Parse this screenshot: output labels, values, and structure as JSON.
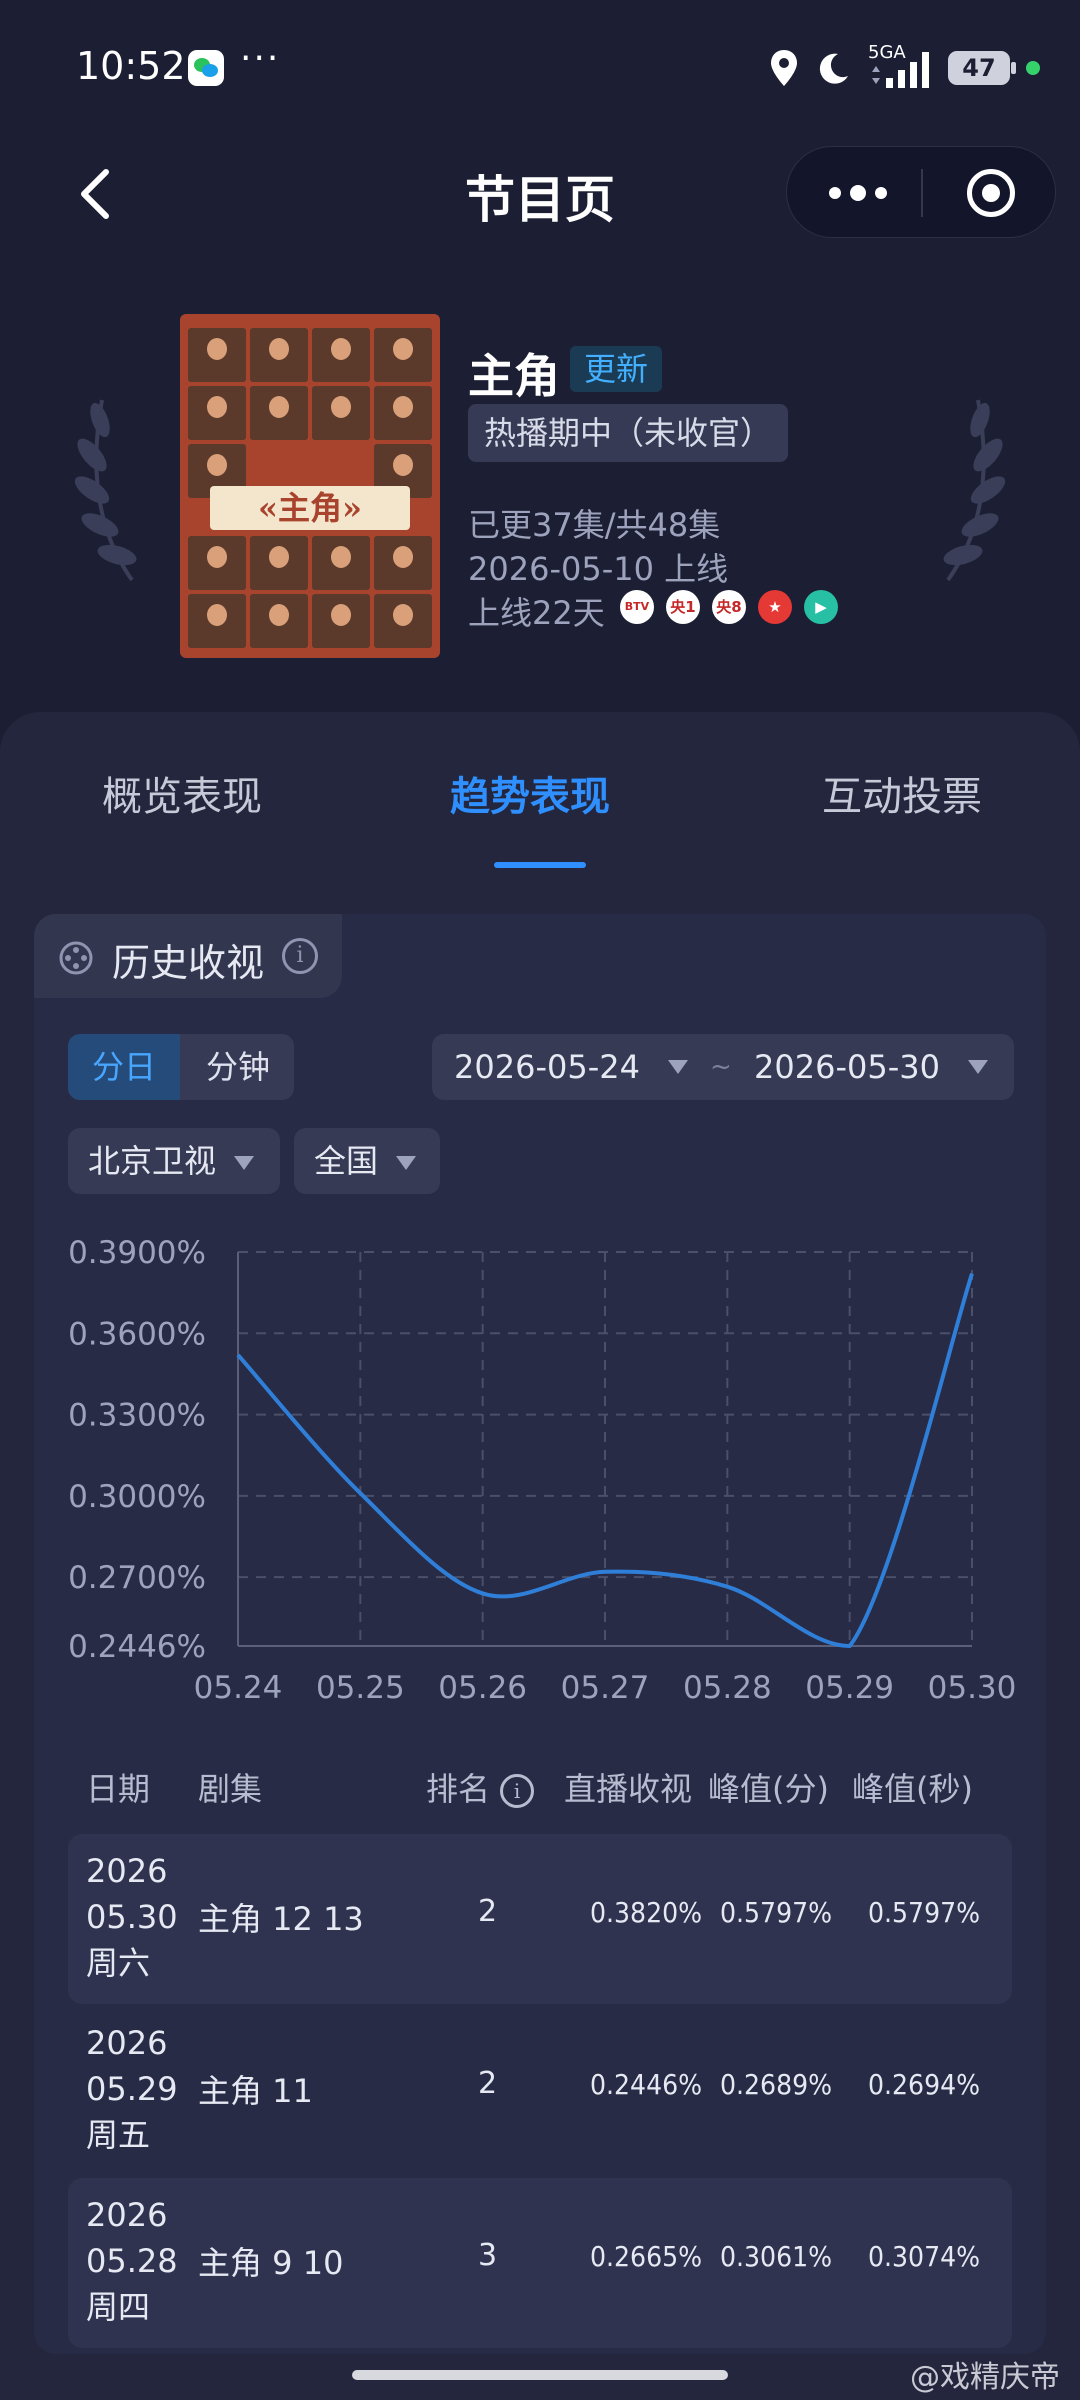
{
  "status_bar": {
    "time": "10:52",
    "more": "···",
    "network": "5GA",
    "battery": "47"
  },
  "nav": {
    "title": "节目页",
    "back_icon": "chevron-left-icon",
    "capsule_icons": [
      "more-icon",
      "target-icon"
    ]
  },
  "show": {
    "name": "主角",
    "badge": "更新",
    "status": "热播期中（未收官）",
    "episodes": "已更37集/共48集",
    "premiere": "2026-05-10 上线",
    "days": "上线22天",
    "poster_title": "«主角»",
    "channels": [
      "BTV",
      "央1",
      "央8",
      "东方",
      "腾讯"
    ]
  },
  "tabs": [
    {
      "label": "概览表现",
      "active": false
    },
    {
      "label": "趋势表现",
      "active": true
    },
    {
      "label": "互动投票",
      "active": false
    }
  ],
  "card": {
    "title": "历史收视",
    "info": "i"
  },
  "filters": {
    "granularity": [
      {
        "label": "分日",
        "active": true
      },
      {
        "label": "分钟",
        "active": false
      }
    ],
    "date_start": "2026-05-24",
    "date_sep": "~",
    "date_end": "2026-05-30",
    "channel": "北京卫视",
    "region": "全国"
  },
  "chart_data": {
    "type": "line",
    "x": [
      "05.24",
      "05.25",
      "05.26",
      "05.27",
      "05.28",
      "05.29",
      "05.30"
    ],
    "series": [
      {
        "values": [
          0.352,
          0.301,
          0.264,
          0.272,
          0.2665,
          0.2446,
          0.382
        ]
      }
    ],
    "yticks": [
      "0.3900%",
      "0.3600%",
      "0.3300%",
      "0.3000%",
      "0.2700%",
      "0.2446%"
    ],
    "ylim": [
      0.2446,
      0.39
    ],
    "grid": true,
    "color": "#2f7fd8"
  },
  "table": {
    "headers": {
      "date": "日期",
      "episode": "剧集",
      "rank": "排名",
      "live": "直播收视",
      "peak_min": "峰值(分)",
      "peak_sec": "峰值(秒)"
    },
    "rows": [
      {
        "year": "2026",
        "md": "05.30",
        "weekday": "周六",
        "episode": "主角 12 13",
        "rank": "2",
        "live": "0.3820%",
        "peak_min": "0.5797%",
        "peak_sec": "0.5797%"
      },
      {
        "year": "2026",
        "md": "05.29",
        "weekday": "周五",
        "episode": "主角 11",
        "rank": "2",
        "live": "0.2446%",
        "peak_min": "0.2689%",
        "peak_sec": "0.2694%"
      },
      {
        "year": "2026",
        "md": "05.28",
        "weekday": "周四",
        "episode": "主角 9 10",
        "rank": "3",
        "live": "0.2665%",
        "peak_min": "0.3061%",
        "peak_sec": "0.3074%"
      }
    ]
  },
  "watermark": "@戏精庆帝"
}
